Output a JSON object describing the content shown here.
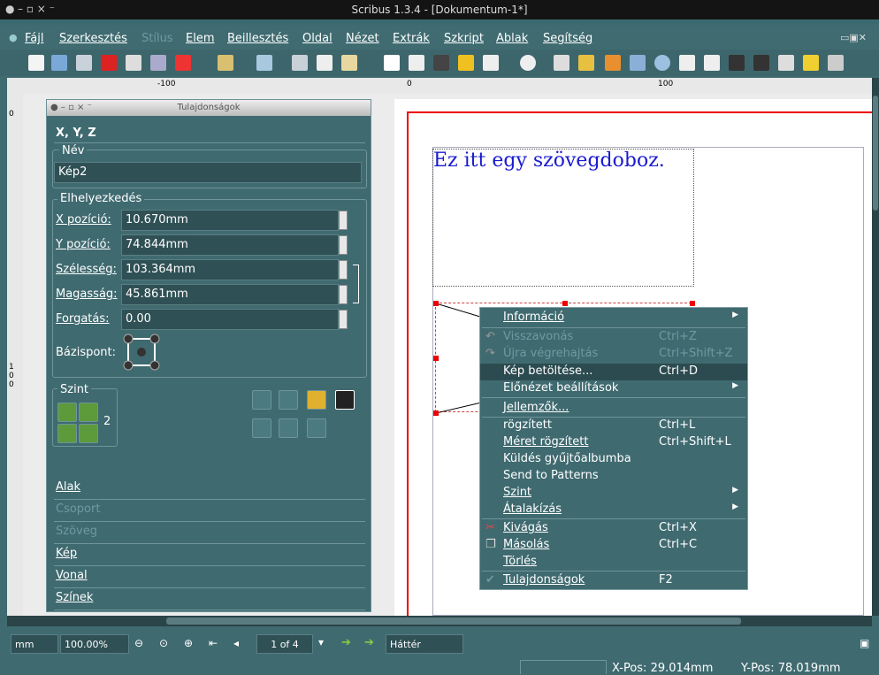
{
  "window": {
    "title": "Scribus 1.3.4 - [Dokumentum-1*]"
  },
  "menubar": [
    "Fájl",
    "Szerkesztés",
    "Stílus",
    "Elem",
    "Beillesztés",
    "Oldal",
    "Nézet",
    "Extrák",
    "Szkript",
    "Ablak",
    "Segítség"
  ],
  "ruler": {
    "h_minus100": "-100",
    "h_zero": "0",
    "h_100": "100",
    "v_zero": "0",
    "v_100": "100"
  },
  "canvas": {
    "text_frame": "Ez itt egy szövegdoboz."
  },
  "props": {
    "title": "Tulajdonságok",
    "header": "X, Y, Z",
    "name_label": "Név",
    "name_value": "Kép2",
    "pos_group": "Elhelyezkedés",
    "x_label": "X pozíció:",
    "x_value": "10.670mm",
    "y_label": "Y pozíció:",
    "y_value": "74.844mm",
    "w_label": "Szélesség:",
    "w_value": "103.364mm",
    "h_label": "Magasság:",
    "h_value": "45.861mm",
    "rot_label": "Forgatás:",
    "rot_value": "0.00",
    "base_label": "Bázispont:",
    "level_group": "Szint",
    "level_value": "2",
    "sections": [
      "Alak",
      "Csoport",
      "Szöveg",
      "Kép",
      "Vonal",
      "Színek"
    ]
  },
  "context_menu": [
    {
      "label": "Információ",
      "shortcut": "",
      "sub": true,
      "enabled": true
    },
    {
      "label": "Visszavonás",
      "shortcut": "Ctrl+Z",
      "sub": false,
      "enabled": false
    },
    {
      "label": "Újra végrehajtás",
      "shortcut": "Ctrl+Shift+Z",
      "sub": false,
      "enabled": false
    },
    {
      "label": "Kép betöltése...",
      "shortcut": "Ctrl+D",
      "sub": false,
      "enabled": true
    },
    {
      "label": "Előnézet beállítások",
      "shortcut": "",
      "sub": true,
      "enabled": true
    },
    {
      "label": "Jellemzők...",
      "shortcut": "",
      "sub": false,
      "enabled": true
    },
    {
      "label": "rögzített",
      "shortcut": "Ctrl+L",
      "sub": false,
      "enabled": true
    },
    {
      "label": "Méret rögzített",
      "shortcut": "Ctrl+Shift+L",
      "sub": false,
      "enabled": true
    },
    {
      "label": "Küldés gyűjtőalbumba",
      "shortcut": "",
      "sub": false,
      "enabled": true
    },
    {
      "label": "Send to Patterns",
      "shortcut": "",
      "sub": false,
      "enabled": true
    },
    {
      "label": "Szint",
      "shortcut": "",
      "sub": true,
      "enabled": true
    },
    {
      "label": "Átalakízás",
      "shortcut": "",
      "sub": true,
      "enabled": true
    },
    {
      "label": "Kivágás",
      "shortcut": "Ctrl+X",
      "sub": false,
      "enabled": true
    },
    {
      "label": "Másolás",
      "shortcut": "Ctrl+C",
      "sub": false,
      "enabled": true
    },
    {
      "label": "Törlés",
      "shortcut": "",
      "sub": false,
      "enabled": true
    },
    {
      "label": "Tulajdonságok",
      "shortcut": "F2",
      "sub": false,
      "enabled": true
    }
  ],
  "bottom": {
    "unit": "mm",
    "zoom": "100.00%",
    "page": "1 of 4",
    "layer": "Háttér"
  },
  "status": {
    "xpos": "X-Pos: 29.014mm",
    "ypos": "Y-Pos: 78.019mm"
  }
}
